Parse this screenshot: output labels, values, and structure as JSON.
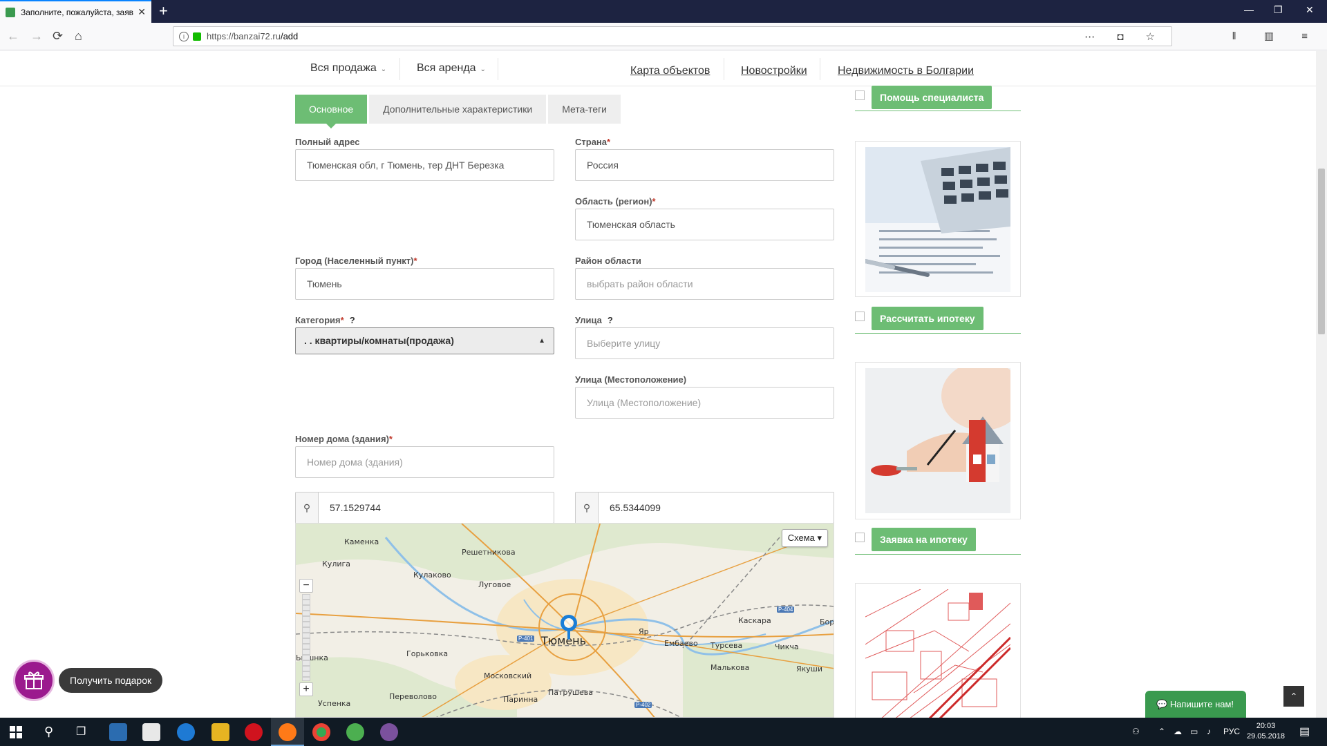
{
  "browser": {
    "tab_title": "Заполните, пожалуйста, заяв",
    "url_host": "https://banzai72.ru",
    "url_path": "/add"
  },
  "site_nav": {
    "dropdowns": [
      "Вся продажа",
      "Вся аренда"
    ],
    "links": [
      "Карта объектов",
      "Новостройки",
      "Недвижимость в Болгарии"
    ]
  },
  "form_tabs": [
    "Основное",
    "Дополнительные характеристики",
    "Мета-теги"
  ],
  "form": {
    "full_address_label": "Полный адрес",
    "full_address_value": "Тюменская обл, г Тюмень, тер ДНТ Березка",
    "country_label": "Страна",
    "country_value": "Россия",
    "region_label": "Область (регион)",
    "region_value": "Тюменская область",
    "city_label": "Город (Населенный пункт)",
    "city_value": "Тюмень",
    "district_label": "Район области",
    "district_placeholder": "выбрать район области",
    "category_label": "Категория",
    "category_value": ". . квартиры/комнаты(продажа)",
    "street_label": "Улица",
    "street_placeholder": "Выберите улицу",
    "street_location_label": "Улица (Местоположение)",
    "street_location_placeholder": "Улица (Местоположение)",
    "house_label": "Номер дома (здания)",
    "house_placeholder": "Номер дома (здания)",
    "latitude": "57.1529744",
    "longitude": "65.5344099",
    "required_mark": "*",
    "help_mark": "?"
  },
  "map": {
    "layer_button": "Схема ▾",
    "zoom_in": "+",
    "zoom_out": "−",
    "places": [
      "Каменка",
      "Кулига",
      "Решетникова",
      "Кулаково",
      "Луговое",
      "Тюмень",
      "Яр",
      "Ембаево",
      "Турсева",
      "Каскара",
      "Бор",
      "Чикча",
      "Малькова",
      "Якуши",
      "Горьковка",
      "Московский",
      "Патрушева",
      "Переволово",
      "Успенка",
      "Паринна",
      "Ьышнка"
    ],
    "road_tags": [
      "Р-401",
      "Р-404",
      "Р-402"
    ]
  },
  "sidebar": {
    "buttons": [
      "Помощь специалиста",
      "Рассчитать ипотеку",
      "Заявка на ипотеку"
    ]
  },
  "widgets": {
    "gift_label": "Получить подарок",
    "chat_label": "Напишите нам!",
    "to_top": "⌃"
  },
  "taskbar": {
    "lang": "РУС",
    "time": "20:03",
    "date": "29.05.2018"
  },
  "colors": {
    "accent_green": "#6dbd74",
    "required_red": "#c0392b",
    "gift_purple": "#9b1a8e"
  }
}
